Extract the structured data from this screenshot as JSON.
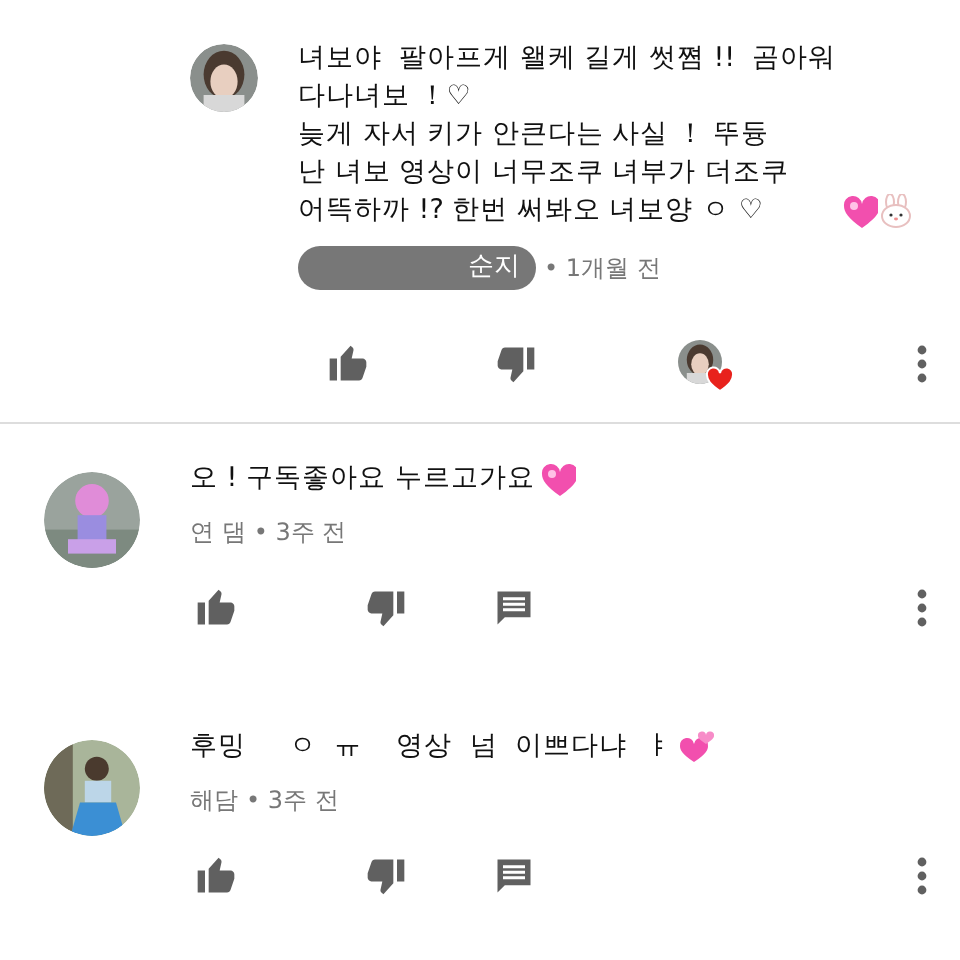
{
  "comments": [
    {
      "kind": "reply",
      "author": "순지",
      "author_badge": true,
      "time": "• 1개월 전",
      "text": "녀보야  팔아프게 왤케 길게 썻쪔 !!  곰아워\n다나녀보 ！♡\n늦게 자서 키가 안큰다는 사실 ！ 뚜듕\n난 녀보 영상이 너무조쿠 녀부가 더조쿠\n어뜩하까 !? 한번 써봐오 녀보양 ㅇ ♡ ",
      "hearted": true
    },
    {
      "kind": "top",
      "author": "연 댐",
      "author_badge": false,
      "time": "• 3주 전",
      "text": "오 ! 구독좋아요 누르고가요",
      "hearted": false
    },
    {
      "kind": "top",
      "author": "해담",
      "author_badge": false,
      "time": "• 3주 전",
      "text": "후밍     ㅇ  ㅠ    영상  넘  이쁘다냐  ㅑ    ",
      "hearted": false
    }
  ]
}
